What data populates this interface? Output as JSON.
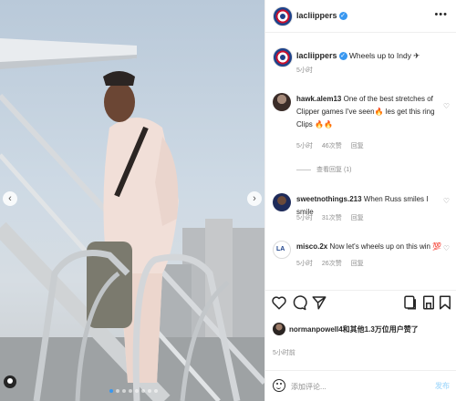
{
  "post": {
    "username": "lacliippers",
    "verified_label": "✓",
    "more_label": "•••"
  },
  "caption": {
    "username": "lacliippers",
    "text": "Wheels up to Indy ✈",
    "time": "5小时"
  },
  "comments": [
    {
      "username": "hawk.alem13",
      "text": "One of the best stretches of Clipper games I've seen🔥 les get this ring Clips 🔥🔥",
      "time": "5小时",
      "likes": "46次赞",
      "reply": "回复",
      "view_replies": "查看回复 (1)"
    },
    {
      "username": "sweetnothings.213",
      "text": "When Russ smiles I smile",
      "time": "5小时",
      "likes": "31次赞",
      "reply": "回复"
    },
    {
      "username": "misco.2x",
      "text": "Now let's wheels up on this win 💯",
      "time": "5小时",
      "likes": "26次赞",
      "reply": "回复"
    }
  ],
  "likes": {
    "text": "normanpowell4和其他1.3万位用户赞了"
  },
  "post_time": "5小时前",
  "add_comment": {
    "placeholder": "添加评论...",
    "post_label": "发布"
  },
  "carousel": {
    "prev": "‹",
    "next": "›",
    "slide_count": 8,
    "active_index": 0
  },
  "icons": [
    "heart-icon",
    "comment-icon",
    "share-icon",
    "carousel-icon",
    "tag-icon",
    "save-icon",
    "emoji-icon"
  ],
  "colors": {
    "verified": "#3897f0",
    "brand_red": "#c8102e",
    "brand_blue": "#1d428a"
  }
}
